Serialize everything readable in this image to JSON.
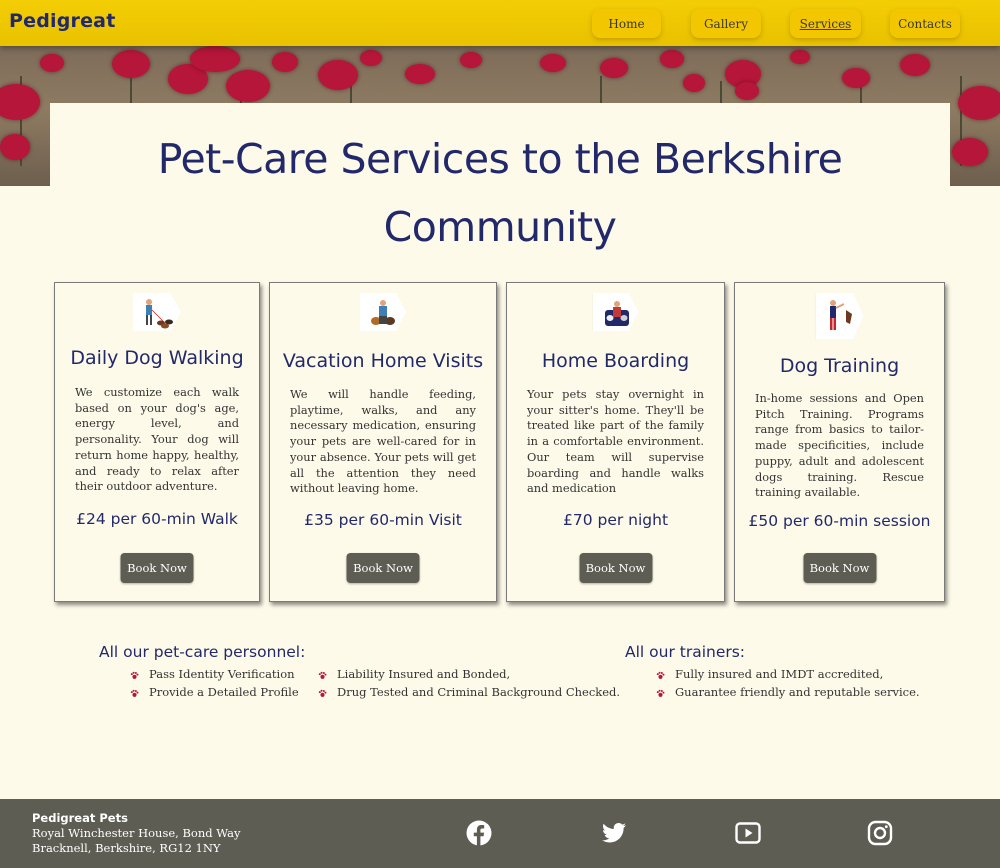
{
  "header": {
    "brand": "Pedigreat",
    "nav": [
      {
        "label": "Home",
        "active": false
      },
      {
        "label": "Gallery",
        "active": false
      },
      {
        "label": "Services",
        "active": true
      },
      {
        "label": "Contacts",
        "active": false
      }
    ]
  },
  "hero": {
    "title_line1": "Pet-Care Services to the Berkshire",
    "title_line2": "Community"
  },
  "services": [
    {
      "icon": "dog-walker-icon",
      "title": "Daily Dog Walking",
      "description": "We customize each walk based on your dog's age, energy level, and personality. Your dog will return home happy, healthy, and ready to relax after their outdoor adventure.",
      "price": "£24 per 60-min Walk",
      "button": "Book Now"
    },
    {
      "icon": "pet-sitter-icon",
      "title": "Vacation Home Visits",
      "description": "We will handle feeding, playtime, walks, and any necessary medication, ensuring your pets are well-cared for in your absence. Your pets will get all the attention they need without leaving home.",
      "price": "£35 per 60-min Visit",
      "button": "Book Now"
    },
    {
      "icon": "home-boarding-icon",
      "title": "Home Boarding",
      "description": "Your pets stay overnight in your sitter's home. They'll be treated like part of the family in a comfortable environment. Our team will supervise boarding and handle walks and medication",
      "price": "£70 per night",
      "button": "Book Now"
    },
    {
      "icon": "dog-trainer-icon",
      "title": "Dog Training",
      "description": "In-home sessions and Open Pitch Training. Programs range from basics to tailor-made specificities, include puppy, adult and adolescent dogs training. Rescue training available.",
      "price": "£50 per 60-min session",
      "button": "Book Now"
    }
  ],
  "personnel": {
    "heading": "All our pet-care personnel:",
    "items": [
      "Pass Identity Verification",
      "Provide a Detailed Profile",
      "Liability Insured and Bonded,",
      "Drug Tested and Criminal Background Checked."
    ]
  },
  "trainers": {
    "heading": "All our trainers:",
    "items": [
      "Fully insured and IMDT accredited,",
      "Guarantee friendly and reputable service."
    ]
  },
  "footer": {
    "company": "Pedigreat Pets",
    "address_line1": "Royal Winchester House, Bond Way",
    "address_line2": "Bracknell, Berkshire, RG12 1NY",
    "social": [
      "facebook-icon",
      "twitter-icon",
      "youtube-icon",
      "instagram-icon"
    ]
  },
  "colors": {
    "header": "#f3cd04",
    "accent_text": "#22296b",
    "background": "#fdfae9",
    "button": "#5d5d53",
    "footer": "#5d5d53"
  }
}
